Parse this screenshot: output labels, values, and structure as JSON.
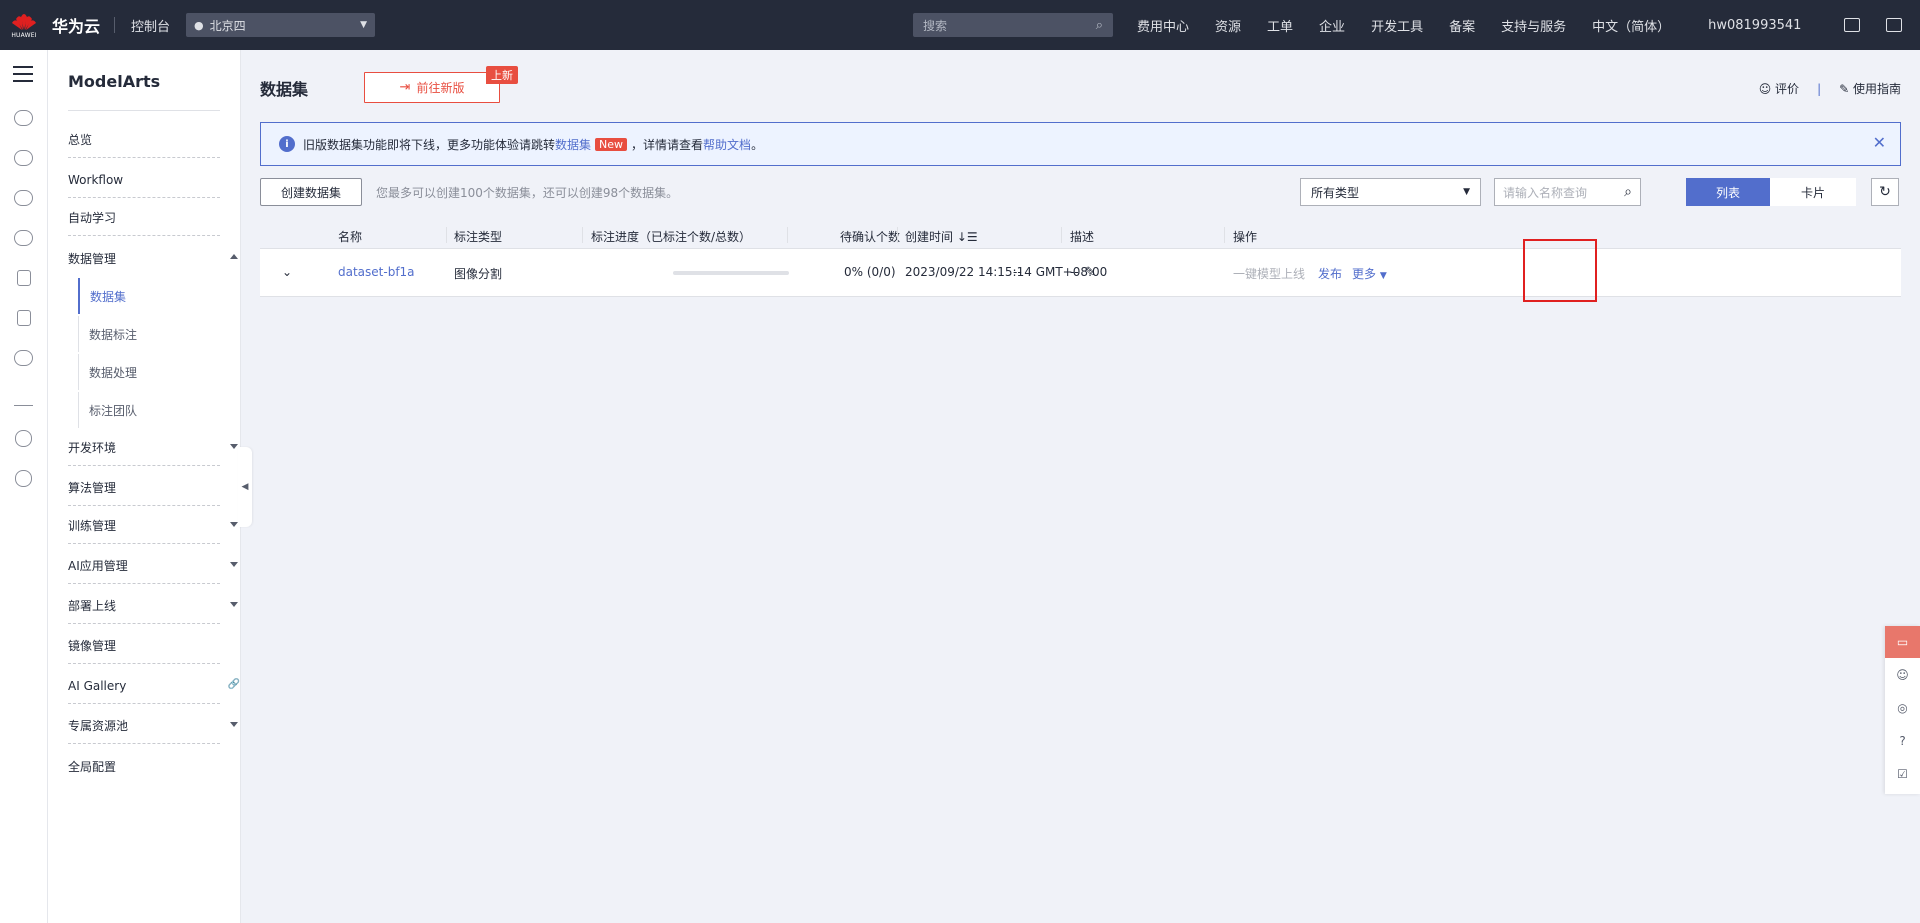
{
  "header": {
    "brand": "华为云",
    "logo_text": "HUAWEI",
    "console": "控制台",
    "region": "北京四",
    "search_placeholder": "搜索",
    "nav": [
      "费用中心",
      "资源",
      "工单",
      "企业",
      "开发工具",
      "备案",
      "支持与服务",
      "中文（简体）"
    ],
    "user": "hw081993541",
    "icons": [
      "terminal-icon",
      "mail-icon"
    ]
  },
  "rail": {
    "icons": [
      "cloud-icon",
      "cluster-icon",
      "chart-icon",
      "cloud-server-icon",
      "document-icon",
      "file-icon",
      "cloud-upload-icon",
      "network-icon",
      "globe-icon",
      "ip-icon"
    ]
  },
  "sidebar": {
    "title": "ModelArts",
    "items": [
      {
        "label": "总览"
      },
      {
        "label": "Workflow"
      },
      {
        "label": "自动学习"
      },
      {
        "label": "数据管理",
        "expanded": true
      },
      {
        "label": "开发环境"
      },
      {
        "label": "算法管理"
      },
      {
        "label": "训练管理"
      },
      {
        "label": "AI应用管理"
      },
      {
        "label": "部署上线"
      },
      {
        "label": "镜像管理"
      },
      {
        "label": "AI Gallery"
      },
      {
        "label": "专属资源池"
      },
      {
        "label": "全局配置"
      }
    ],
    "sub_items": [
      {
        "label": "数据集",
        "active": true
      },
      {
        "label": "数据标注"
      },
      {
        "label": "数据处理"
      },
      {
        "label": "标注团队"
      }
    ]
  },
  "page": {
    "title": "数据集",
    "new_version_button": "前往新版",
    "new_badge": "上新",
    "rate_label": "评价",
    "guide_label": "使用指南"
  },
  "notice": {
    "text_before": "旧版数据集功能即将下线，更多功能体验请跳转",
    "link1": "数据集",
    "tag": "New",
    "text_middle": "，详情请查看",
    "link2": "帮助文档",
    "text_after": "。"
  },
  "toolbar": {
    "create_button": "创建数据集",
    "quota_text": "您最多可以创建100个数据集，还可以创建98个数据集。",
    "type_select_value": "所有类型",
    "name_search_placeholder": "请输入名称查询",
    "list_view": "列表",
    "card_view": "卡片"
  },
  "table": {
    "headers": {
      "name": "名称",
      "label_type": "标注类型",
      "progress": "标注进度（已标注个数/总数）",
      "pending": "待确认个数",
      "created": "创建时间",
      "description": "描述",
      "actions": "操作"
    },
    "rows": [
      {
        "name": "dataset-bf1a",
        "label_type": "图像分割",
        "progress_fraction": 0,
        "progress_text": "0% (0/0)",
        "pending": "--",
        "created": "2023/09/22 14:15:14 GMT+08:00",
        "description": "--",
        "action_launch": "一键模型上线",
        "action_publish": "发布",
        "action_more": "更多"
      }
    ]
  },
  "colors": {
    "topbar": "#252b3a",
    "accent": "#526ecc",
    "danger": "#e84e40",
    "highlight_box": "#e02020"
  }
}
